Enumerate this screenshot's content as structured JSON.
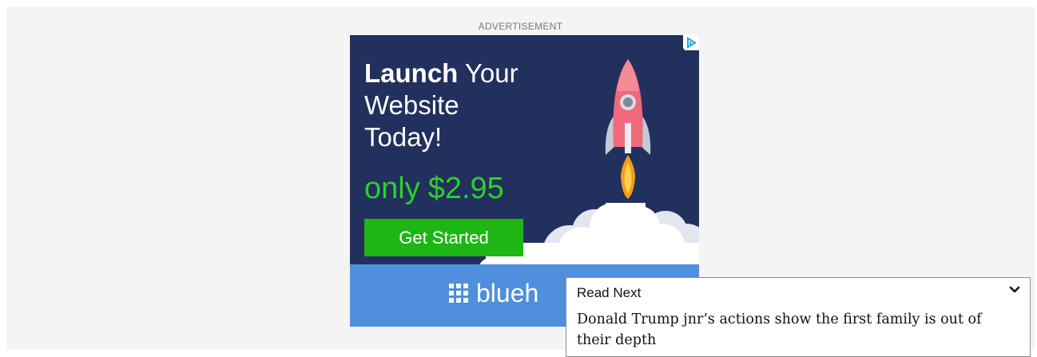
{
  "ad_label": "ADVERTISEMENT",
  "banner": {
    "headline_bold": "Launch",
    "headline_rest": " Your",
    "headline_line2": "Website",
    "headline_line3": "Today!",
    "price_prefix": "only",
    "price": "$2.95",
    "cta_label": "Get Started",
    "brand_visible": "blueh",
    "colors": {
      "background": "#22305e",
      "accent_green": "#2fcf2a",
      "button_green": "#1db615",
      "brand_bar": "#4f8fdc"
    }
  },
  "read_next": {
    "label": "Read Next",
    "headline": "Donald Trump jnr’s actions show the first family is out of their depth",
    "toggle_icon": "chevron-down-icon"
  }
}
